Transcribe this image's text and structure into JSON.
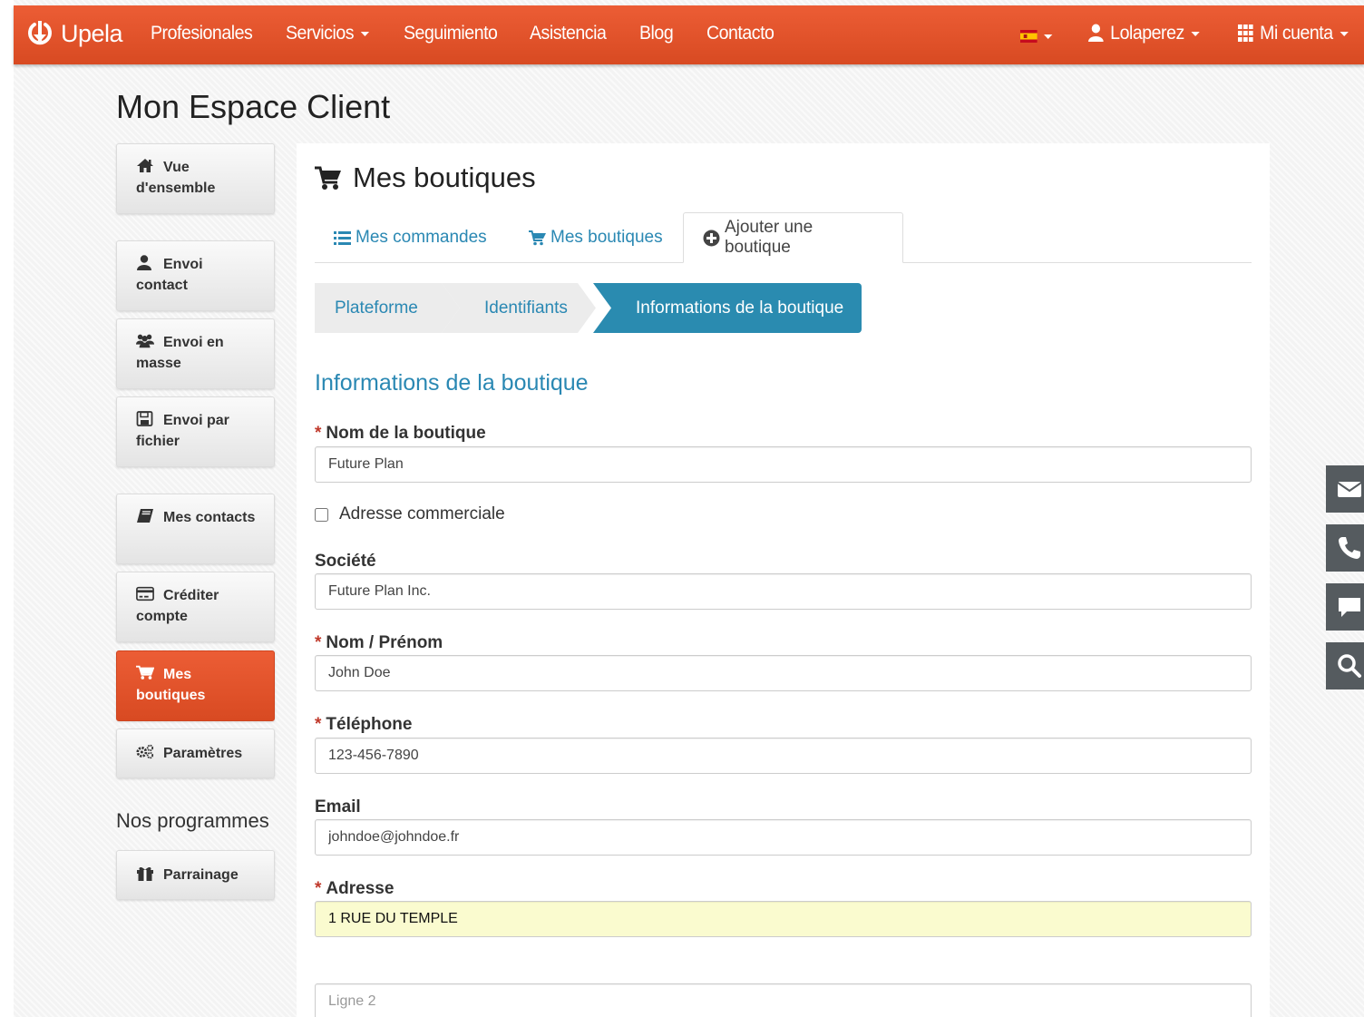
{
  "navbar": {
    "brand": "Upela",
    "items": {
      "profesionales": "Profesionales",
      "servicios": "Servicios",
      "seguimiento": "Seguimiento",
      "asistencia": "Asistencia",
      "blog": "Blog",
      "contacto": "Contacto"
    },
    "user": "Lolaperez",
    "account": "Mi cuenta"
  },
  "page": {
    "title": "Mon Espace Client"
  },
  "sidebar": {
    "items": [
      {
        "label": "Vue d'ensemble",
        "icon": "home-icon"
      },
      {
        "label": "Envoi contact",
        "icon": "user-icon"
      },
      {
        "label": "Envoi en masse",
        "icon": "users-icon"
      },
      {
        "label": "Envoi par fichier",
        "icon": "floppy-icon"
      },
      {
        "label": "Mes contacts",
        "icon": "book-icon"
      },
      {
        "label": "Créditer compte",
        "icon": "credit-card-icon"
      },
      {
        "label": "Mes boutiques",
        "icon": "cart-icon",
        "active": true
      },
      {
        "label": "Paramètres",
        "icon": "gears-icon"
      }
    ],
    "section_title": "Nos programmes",
    "program": {
      "label": "Parrainage",
      "icon": "gift-icon"
    }
  },
  "panel": {
    "title": "Mes boutiques",
    "tabs": [
      {
        "label": "Mes commandes"
      },
      {
        "label": "Mes boutiques"
      },
      {
        "label": "Ajouter une boutique",
        "active": true
      }
    ],
    "steps": [
      "Plateforme",
      "Identifiants",
      "Informations de la boutique"
    ],
    "section_title": "Informations de la boutique"
  },
  "form": {
    "shop_name": {
      "label": "Nom de la boutique",
      "value": "Future Plan"
    },
    "commercial_address": {
      "label": "Adresse commerciale",
      "checked": false
    },
    "company": {
      "label": "Société",
      "value": "Future Plan Inc."
    },
    "name": {
      "label": "Nom / Prénom",
      "value": "John Doe"
    },
    "phone": {
      "label": "Téléphone",
      "value": "123-456-7890"
    },
    "email": {
      "label": "Email",
      "value": "johndoe@johndoe.fr"
    },
    "address": {
      "label": "Adresse",
      "value": "1 RUE DU TEMPLE"
    },
    "address2": {
      "placeholder": "Ligne 2",
      "value": ""
    },
    "required_marker": "*"
  },
  "colors": {
    "brand": "#e4532b",
    "link": "#2a88b3",
    "step_active": "#2a8bb0",
    "float_bg": "#555b5f",
    "autofill": "#fafbcf"
  }
}
